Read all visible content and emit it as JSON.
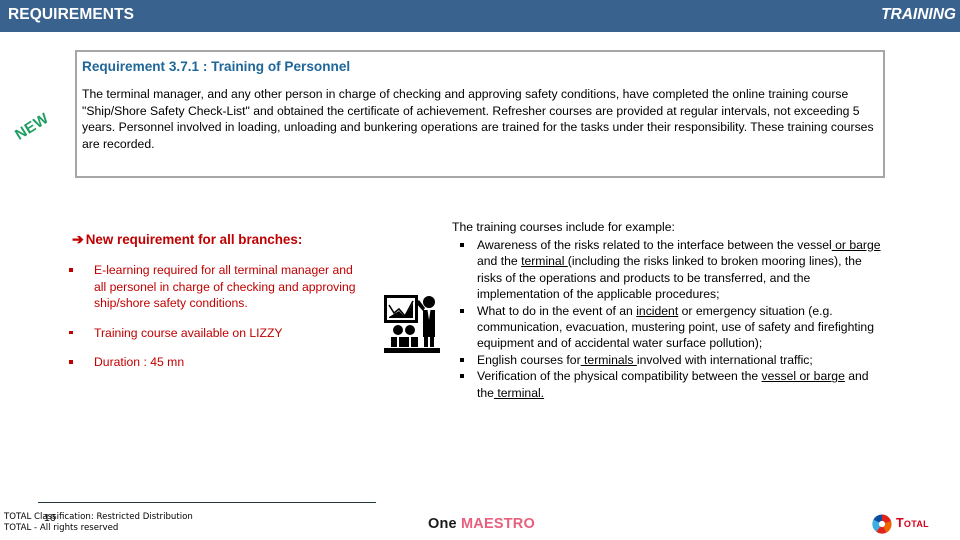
{
  "header": {
    "title": "REQUIREMENTS",
    "right_label": "TRAINING"
  },
  "badge": {
    "new_label": "NEW"
  },
  "requirement_box": {
    "title": "Requirement 3.7.1 : Training of Personnel",
    "body": "The terminal manager, and any other person in charge of checking and approving safety conditions, have completed the online training course \"Ship/Shore Safety Check-List\" and obtained the certificate of achievement. Refresher courses are provided at regular intervals, not exceeding 5 years. Personnel involved in loading, unloading and bunkering operations are trained for the tasks under their responsibility. These training courses are recorded."
  },
  "left_column": {
    "arrow": "➔",
    "heading": "New requirement for all branches:",
    "bullets": [
      "E-learning required for all terminal manager and all personel in charge of checking and approving ship/shore safety conditions.",
      "Training course available on LIZZY",
      "Duration : 45 mn"
    ]
  },
  "icon": {
    "name": "training-presentation-icon"
  },
  "right_column": {
    "intro": "The training courses include for example:",
    "bullets": [
      "Awareness of the risks related to the interface between the vessel or barge and the terminal (including the risks linked to broken mooring lines), the risks of the operations and products to be transferred, and the implementation of the applicable procedures;",
      "What to do in the event of an incident or emergency situation (e.g. communication, evacuation, mustering point, use of safety and firefighting equipment and of accidental water surface pollution);",
      "English courses for terminals involved with international traffic;",
      "Verification of the physical compatibility between the vessel or barge and the terminal."
    ]
  },
  "footer": {
    "page_number": "16",
    "classification": "TOTAL Classification: Restricted Distribution",
    "rights": "TOTAL - All rights reserved",
    "brand_one": "One ",
    "brand_maestro": "MAESTRO",
    "logo_word": "Total"
  },
  "colors": {
    "header_blue": "#3A628E",
    "title_blue": "#1F6699",
    "accent_red": "#C00000",
    "new_green": "#1F9E63",
    "maestro_pink": "#E8607E",
    "total_red": "#D4001A"
  }
}
